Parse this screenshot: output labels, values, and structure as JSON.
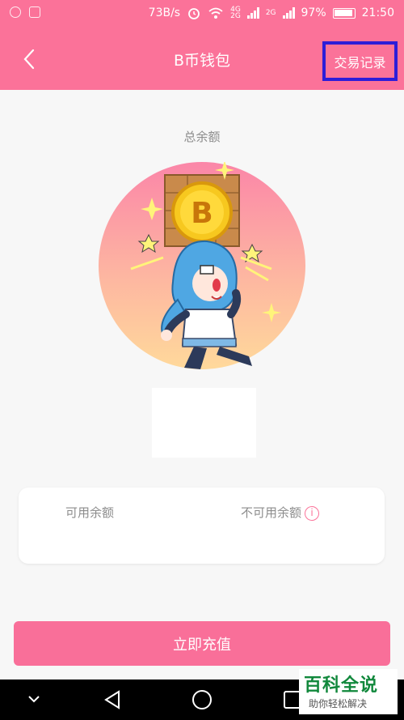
{
  "status_bar": {
    "net_speed": "73B/s",
    "net_4g": "4G",
    "net_2g_a": "2G",
    "net_2g_b": "2G",
    "battery": "97%",
    "time": "21:50"
  },
  "header": {
    "back_icon": "chevron-left-icon",
    "title": "B币钱包",
    "records": "交易记录"
  },
  "main": {
    "balance_label": "总余额",
    "available_label": "可用余额",
    "unavailable_label": "不可用余额",
    "info_icon": "i",
    "recharge": "立即充值"
  },
  "watermark": {
    "title": "百科全说",
    "subtitle": "助你轻松解决"
  },
  "colors": {
    "accent": "#fb7299",
    "highlight_border": "#2e1dd8"
  }
}
